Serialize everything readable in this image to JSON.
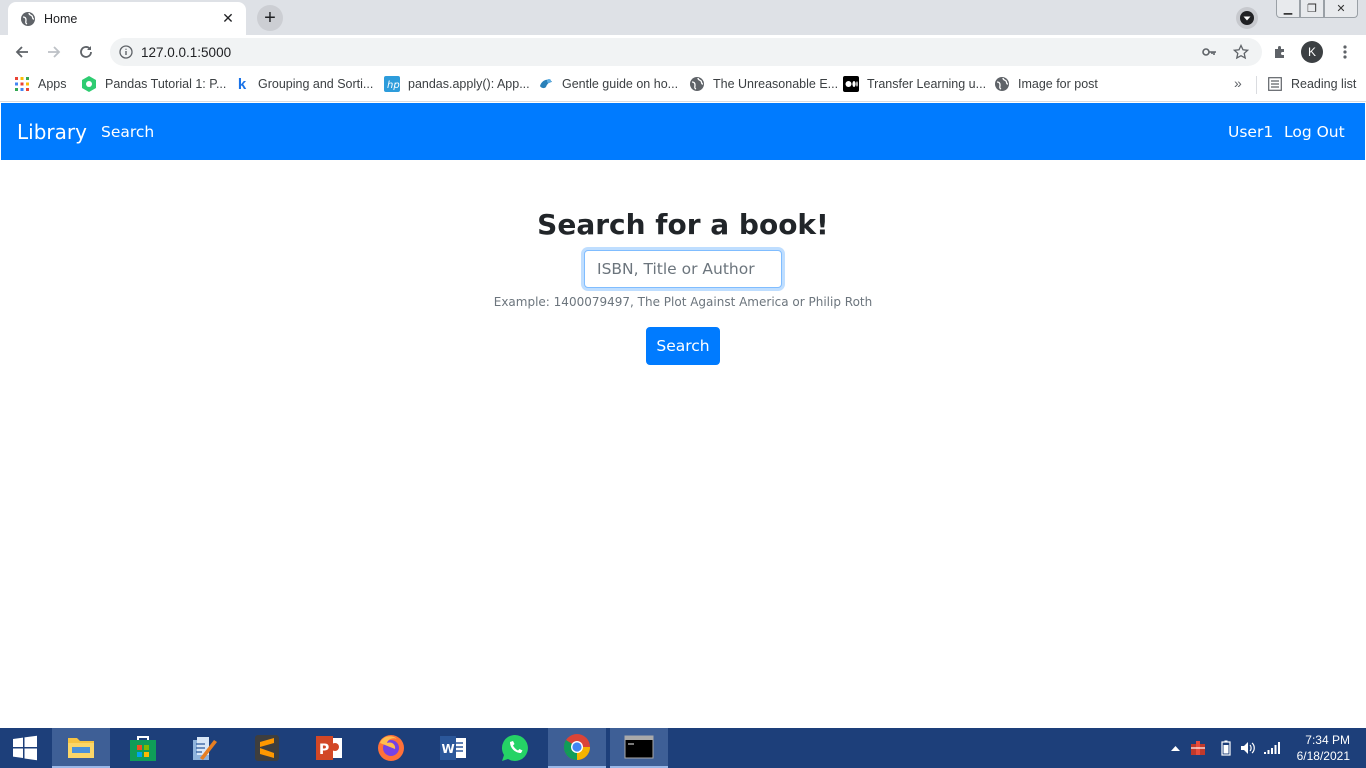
{
  "browser": {
    "tab_title": "Home",
    "url": "127.0.0.1:5000",
    "profile_initial": "K",
    "bookmarks": [
      {
        "label": "Apps",
        "icon": "apps-grid-icon"
      },
      {
        "label": "Pandas Tutorial 1: P...",
        "icon": "pandas-tutorial-icon"
      },
      {
        "label": "Grouping and Sorti...",
        "icon": "k-site-icon"
      },
      {
        "label": "pandas.apply(): App...",
        "icon": "hp-icon"
      },
      {
        "label": "Gentle guide on ho...",
        "icon": "gentle-guide-icon"
      },
      {
        "label": "The Unreasonable E...",
        "icon": "globe-icon"
      },
      {
        "label": "Transfer Learning u...",
        "icon": "medium-icon"
      },
      {
        "label": "Image for post",
        "icon": "globe-icon"
      }
    ],
    "reading_list": "Reading list",
    "more": "»"
  },
  "navbar": {
    "brand": "Library",
    "search_link": "Search",
    "user": "User1",
    "logout": "Log Out"
  },
  "main": {
    "heading": "Search for a book!",
    "input_placeholder": "ISBN, Title or Author",
    "input_value": "",
    "helper_text": "Example: 1400079497, The Plot Against America or Philip Roth",
    "button_label": "Search"
  },
  "taskbar": {
    "time": "7:34 PM",
    "date": "6/18/2021",
    "apps": [
      "windows-start-icon",
      "file-explorer-icon",
      "store-icon",
      "wordpad-icon",
      "sublime-text-icon",
      "powerpoint-icon",
      "firefox-icon",
      "word-icon",
      "whatsapp-icon",
      "chrome-icon",
      "terminal-icon"
    ]
  },
  "colors": {
    "primary": "#007bff",
    "taskbar": "#1d3f7a"
  }
}
